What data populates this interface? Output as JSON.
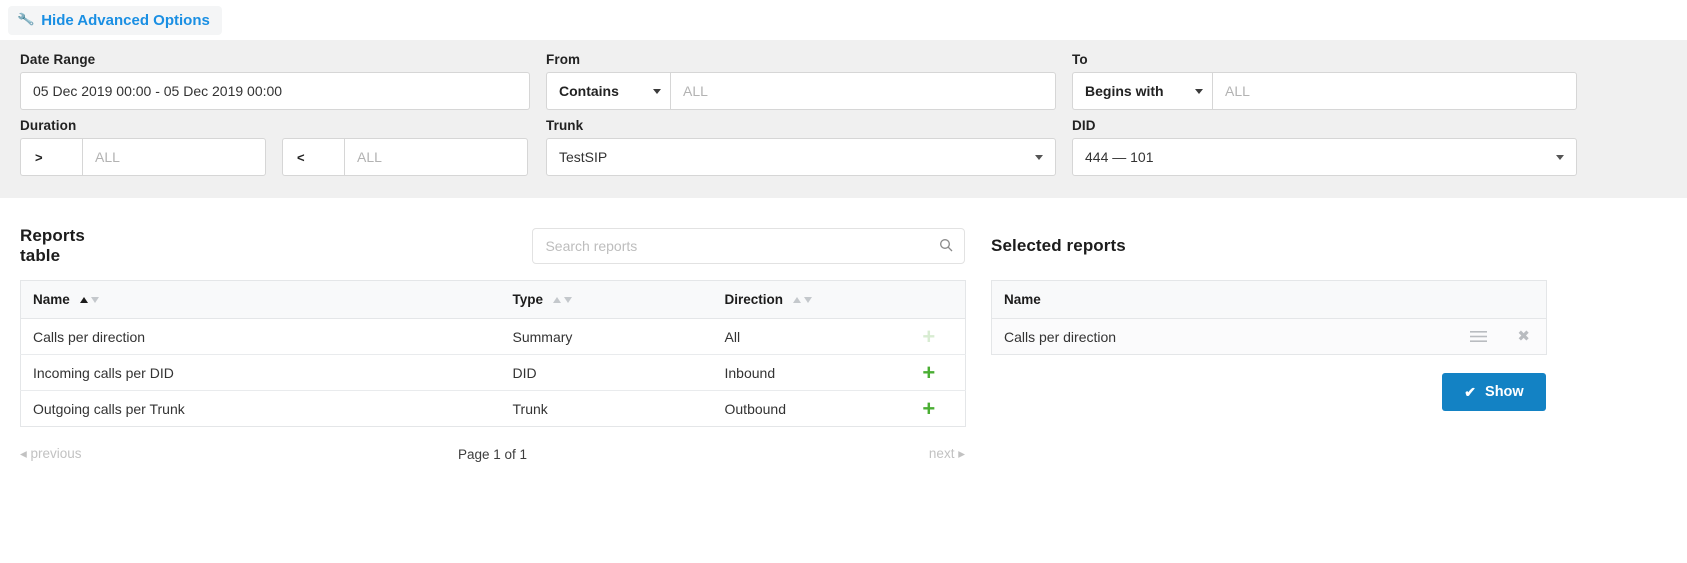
{
  "topbar": {
    "advanced_toggle_label": "Hide Advanced Options",
    "wrench_icon": "wrench-icon",
    "link_color": "#1a8fe3"
  },
  "filters": {
    "date_range": {
      "label": "Date Range",
      "value": "05 Dec 2019 00:00 - 05 Dec 2019 00:00"
    },
    "from": {
      "label": "From",
      "operator": "Contains",
      "value_placeholder": "ALL",
      "value": ""
    },
    "to": {
      "label": "To",
      "operator": "Begins with",
      "value_placeholder": "ALL",
      "value": ""
    },
    "duration": {
      "label": "Duration",
      "min_operator": ">",
      "min_placeholder": "ALL",
      "max_operator": "<",
      "max_placeholder": "ALL"
    },
    "trunk": {
      "label": "Trunk",
      "value": "TestSIP"
    },
    "did": {
      "label": "DID",
      "value": "444  —  101"
    }
  },
  "reports": {
    "title": "Reports table",
    "search_placeholder": "Search reports",
    "search_value": "",
    "search_icon": "search-icon",
    "columns": [
      {
        "label": "Name",
        "sort": "asc"
      },
      {
        "label": "Type",
        "sort": "none"
      },
      {
        "label": "Direction",
        "sort": "none"
      }
    ],
    "rows": [
      {
        "name": "Calls per direction",
        "type": "Summary",
        "direction": "All",
        "add_icon": "plus-icon",
        "add_enabled": false
      },
      {
        "name": "Incoming calls per DID",
        "type": "DID",
        "direction": "Inbound",
        "add_icon": "plus-icon",
        "add_enabled": true
      },
      {
        "name": "Outgoing calls per Trunk",
        "type": "Trunk",
        "direction": "Outbound",
        "add_icon": "plus-icon",
        "add_enabled": true
      }
    ],
    "pagination": {
      "previous_label": "previous",
      "next_label": "next",
      "page_label": "Page 1 of 1"
    }
  },
  "selected": {
    "title": "Selected reports",
    "column_name": "Name",
    "rows": [
      {
        "name": "Calls per direction",
        "drag_icon": "drag-handle-icon",
        "remove_icon": "close-icon"
      }
    ],
    "show_button": {
      "label": "Show",
      "icon": "check-icon",
      "color": "#1382c4"
    }
  }
}
